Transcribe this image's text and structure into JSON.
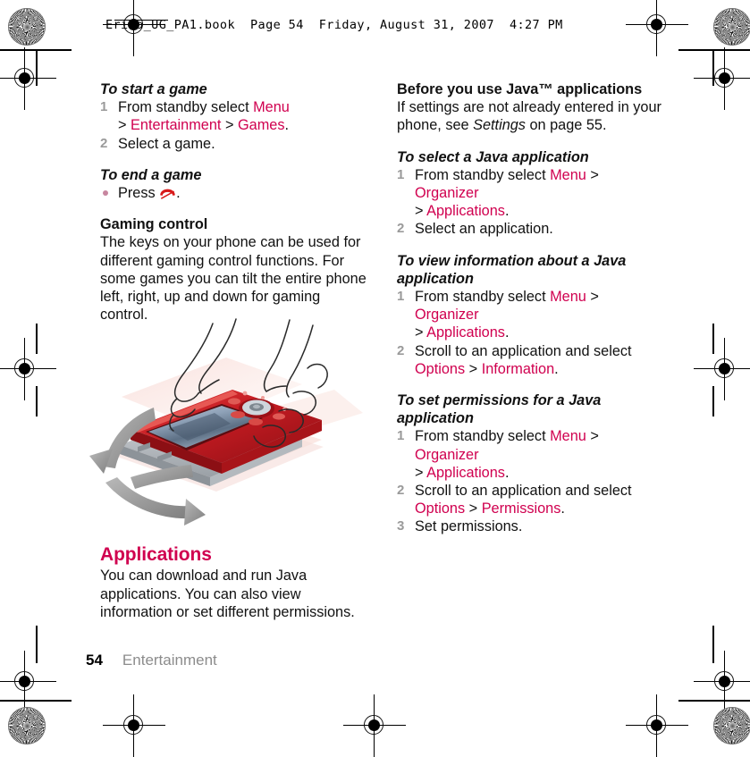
{
  "header": {
    "text": "Erika_UG_PA1.book  Page 54  Friday, August 31, 2007  4:27 PM"
  },
  "footer": {
    "page_number": "54",
    "chapter": "Entertainment"
  },
  "left_column": {
    "proc_start_game": {
      "title": "To start a game",
      "steps": [
        {
          "num": "1",
          "parts": [
            {
              "text": "From standby select ",
              "style": "plain"
            },
            {
              "text": "Menu",
              "style": "pink"
            },
            {
              "text": " > ",
              "style": "plain"
            },
            {
              "text": "Entertainment",
              "style": "pink"
            },
            {
              "text": " > ",
              "style": "plain"
            },
            {
              "text": "Games",
              "style": "pink"
            },
            {
              "text": ".",
              "style": "plain"
            }
          ]
        },
        {
          "num": "2",
          "parts": [
            {
              "text": "Select a game.",
              "style": "plain"
            }
          ]
        }
      ]
    },
    "proc_end_game": {
      "title": "To end a game",
      "bullet_text_before": "Press ",
      "bullet_icon": "end-call-icon",
      "bullet_text_after": "."
    },
    "gaming_control": {
      "title": "Gaming control",
      "body": "The keys on your phone can be used for different gaming control functions. For some games you can tilt the entire phone left, right, up and down for gaming control."
    },
    "illustration": {
      "name": "phone-tilt-illustration",
      "description": "Hands tilting a red slider phone with curved motion arrows"
    },
    "applications_section": {
      "title": "Applications",
      "body": "You can download and run Java applications. You can also view information or set different permissions."
    }
  },
  "right_column": {
    "before_java": {
      "title": "Before you use Java™ applications",
      "body_parts": [
        {
          "text": "If settings are not already entered in your phone, see ",
          "style": "plain"
        },
        {
          "text": "Settings",
          "style": "italic"
        },
        {
          "text": " on page 55.",
          "style": "plain"
        }
      ]
    },
    "proc_select_java": {
      "title": "To select a Java application",
      "steps": [
        {
          "num": "1",
          "parts": [
            {
              "text": "From standby select ",
              "style": "plain"
            },
            {
              "text": "Menu",
              "style": "pink"
            },
            {
              "text": " > ",
              "style": "plain"
            },
            {
              "text": "Organizer",
              "style": "pink"
            },
            {
              "text": " > ",
              "style": "plain"
            },
            {
              "text": "Applications",
              "style": "pink"
            },
            {
              "text": ".",
              "style": "plain"
            }
          ]
        },
        {
          "num": "2",
          "parts": [
            {
              "text": "Select an application.",
              "style": "plain"
            }
          ]
        }
      ]
    },
    "proc_view_info": {
      "title": "To view information about a Java application",
      "steps": [
        {
          "num": "1",
          "parts": [
            {
              "text": "From standby select ",
              "style": "plain"
            },
            {
              "text": "Menu",
              "style": "pink"
            },
            {
              "text": " > ",
              "style": "plain"
            },
            {
              "text": "Organizer",
              "style": "pink"
            },
            {
              "text": " > ",
              "style": "plain"
            },
            {
              "text": "Applications",
              "style": "pink"
            },
            {
              "text": ".",
              "style": "plain"
            }
          ]
        },
        {
          "num": "2",
          "parts": [
            {
              "text": "Scroll to an application and select ",
              "style": "plain"
            },
            {
              "text": "Options",
              "style": "pink"
            },
            {
              "text": " > ",
              "style": "plain"
            },
            {
              "text": "Information",
              "style": "pink"
            },
            {
              "text": ".",
              "style": "plain"
            }
          ]
        }
      ]
    },
    "proc_set_permissions": {
      "title": "To set permissions for a Java application",
      "steps": [
        {
          "num": "1",
          "parts": [
            {
              "text": "From standby select ",
              "style": "plain"
            },
            {
              "text": "Menu",
              "style": "pink"
            },
            {
              "text": " > ",
              "style": "plain"
            },
            {
              "text": "Organizer",
              "style": "pink"
            },
            {
              "text": " > ",
              "style": "plain"
            },
            {
              "text": "Applications",
              "style": "pink"
            },
            {
              "text": ".",
              "style": "plain"
            }
          ]
        },
        {
          "num": "2",
          "parts": [
            {
              "text": "Scroll to an application and select ",
              "style": "plain"
            },
            {
              "text": "Options",
              "style": "pink"
            },
            {
              "text": " > ",
              "style": "plain"
            },
            {
              "text": "Permissions",
              "style": "pink"
            },
            {
              "text": ".",
              "style": "plain"
            }
          ]
        },
        {
          "num": "3",
          "parts": [
            {
              "text": "Set permissions.",
              "style": "plain"
            }
          ]
        }
      ]
    }
  },
  "colors": {
    "accent_pink": "#d0004f",
    "body_text": "#111111",
    "muted_gray": "#8c8c8c",
    "icon_red": "#d81a1a"
  }
}
